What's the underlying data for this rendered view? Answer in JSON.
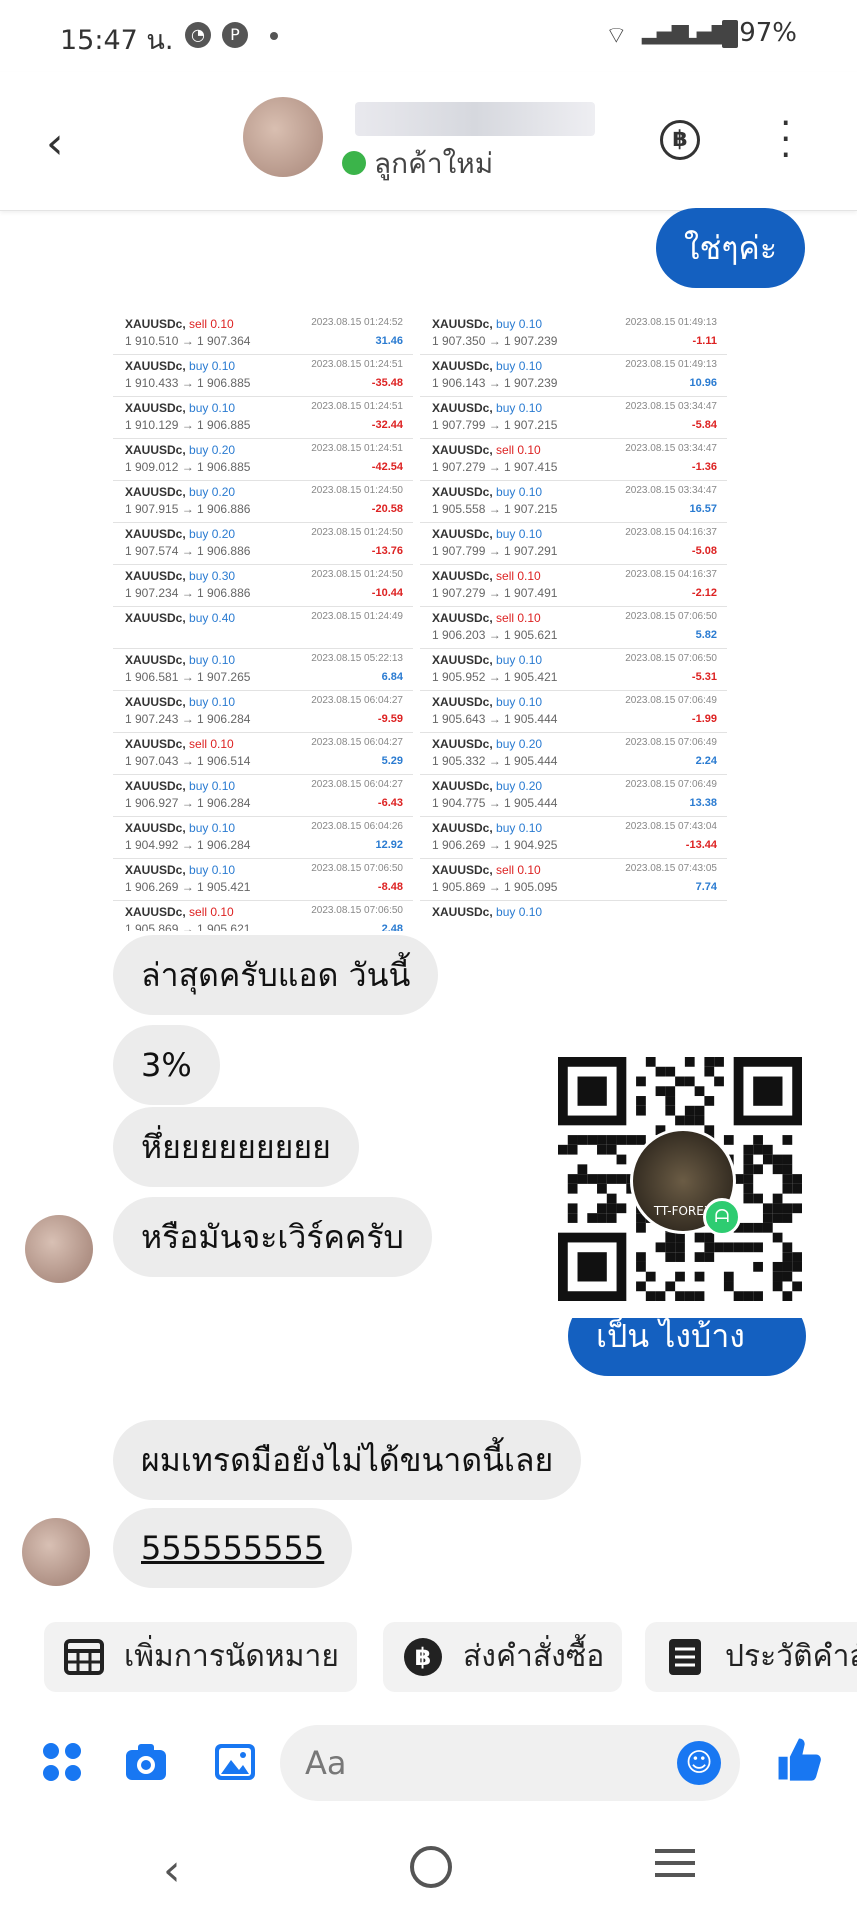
{
  "status_bar": {
    "time": "15:47 น.",
    "right": "97%"
  },
  "header": {
    "status": "ลูกค้าใหม่",
    "currency_symbol": "฿"
  },
  "messages": {
    "out_1": "ใช่ๆค่ะ",
    "in_1": "ล่าสุดครับแอด วันนี้",
    "in_2": "3%",
    "in_3": "หึ่ยยยยยยยยย",
    "in_4": "หรือมันจะเวิร์คครับ",
    "out_2": "เป็น ไงบ้างคะ",
    "in_5": "ผมเทรดมือยังไม่ได้ขนาดนี้เลย",
    "in_6": "555555555"
  },
  "trades_left": [
    {
      "sym": "XAUUSDc,",
      "side": "sell",
      "lot": "0.10",
      "price": "1 910.510 → 1 907.364",
      "date": "2023.08.15 01:24:52",
      "pnl": "31.46"
    },
    {
      "sym": "XAUUSDc,",
      "side": "buy",
      "lot": "0.10",
      "price": "1 910.433 → 1 906.885",
      "date": "2023.08.15 01:24:51",
      "pnl": "-35.48"
    },
    {
      "sym": "XAUUSDc,",
      "side": "buy",
      "lot": "0.10",
      "price": "1 910.129 → 1 906.885",
      "date": "2023.08.15 01:24:51",
      "pnl": "-32.44"
    },
    {
      "sym": "XAUUSDc,",
      "side": "buy",
      "lot": "0.20",
      "price": "1 909.012 → 1 906.885",
      "date": "2023.08.15 01:24:51",
      "pnl": "-42.54"
    },
    {
      "sym": "XAUUSDc,",
      "side": "buy",
      "lot": "0.20",
      "price": "1 907.915 → 1 906.886",
      "date": "2023.08.15 01:24:50",
      "pnl": "-20.58"
    },
    {
      "sym": "XAUUSDc,",
      "side": "buy",
      "lot": "0.20",
      "price": "1 907.574 → 1 906.886",
      "date": "2023.08.15 01:24:50",
      "pnl": "-13.76"
    },
    {
      "sym": "XAUUSDc,",
      "side": "buy",
      "lot": "0.30",
      "price": "1 907.234 → 1 906.886",
      "date": "2023.08.15 01:24:50",
      "pnl": "-10.44"
    },
    {
      "sym": "XAUUSDc,",
      "side": "buy",
      "lot": "0.40",
      "price": "",
      "date": "2023.08.15 01:24:49",
      "pnl": ""
    },
    {
      "sym": "XAUUSDc,",
      "side": "buy",
      "lot": "0.10",
      "price": "1 906.581 → 1 907.265",
      "date": "2023.08.15 05:22:13",
      "pnl": "6.84"
    },
    {
      "sym": "XAUUSDc,",
      "side": "buy",
      "lot": "0.10",
      "price": "1 907.243 → 1 906.284",
      "date": "2023.08.15 06:04:27",
      "pnl": "-9.59"
    },
    {
      "sym": "XAUUSDc,",
      "side": "sell",
      "lot": "0.10",
      "price": "1 907.043 → 1 906.514",
      "date": "2023.08.15 06:04:27",
      "pnl": "5.29"
    },
    {
      "sym": "XAUUSDc,",
      "side": "buy",
      "lot": "0.10",
      "price": "1 906.927 → 1 906.284",
      "date": "2023.08.15 06:04:27",
      "pnl": "-6.43"
    },
    {
      "sym": "XAUUSDc,",
      "side": "buy",
      "lot": "0.10",
      "price": "1 904.992 → 1 906.284",
      "date": "2023.08.15 06:04:26",
      "pnl": "12.92"
    },
    {
      "sym": "XAUUSDc,",
      "side": "buy",
      "lot": "0.10",
      "price": "1 906.269 → 1 905.421",
      "date": "2023.08.15 07:06:50",
      "pnl": "-8.48"
    },
    {
      "sym": "XAUUSDc,",
      "side": "sell",
      "lot": "0.10",
      "price": "1 905.869 → 1 905.621",
      "date": "2023.08.15 07:06:50",
      "pnl": "2.48"
    }
  ],
  "trades_right": [
    {
      "sym": "XAUUSDc,",
      "side": "buy",
      "lot": "0.10",
      "price": "1 907.350 → 1 907.239",
      "date": "2023.08.15 01:49:13",
      "pnl": "-1.11"
    },
    {
      "sym": "XAUUSDc,",
      "side": "buy",
      "lot": "0.10",
      "price": "1 906.143 → 1 907.239",
      "date": "2023.08.15 01:49:13",
      "pnl": "10.96"
    },
    {
      "sym": "XAUUSDc,",
      "side": "buy",
      "lot": "0.10",
      "price": "1 907.799 → 1 907.215",
      "date": "2023.08.15 03:34:47",
      "pnl": "-5.84"
    },
    {
      "sym": "XAUUSDc,",
      "side": "sell",
      "lot": "0.10",
      "price": "1 907.279 → 1 907.415",
      "date": "2023.08.15 03:34:47",
      "pnl": "-1.36"
    },
    {
      "sym": "XAUUSDc,",
      "side": "buy",
      "lot": "0.10",
      "price": "1 905.558 → 1 907.215",
      "date": "2023.08.15 03:34:47",
      "pnl": "16.57"
    },
    {
      "sym": "XAUUSDc,",
      "side": "buy",
      "lot": "0.10",
      "price": "1 907.799 → 1 907.291",
      "date": "2023.08.15 04:16:37",
      "pnl": "-5.08"
    },
    {
      "sym": "XAUUSDc,",
      "side": "sell",
      "lot": "0.10",
      "price": "1 907.279 → 1 907.491",
      "date": "2023.08.15 04:16:37",
      "pnl": "-2.12"
    },
    {
      "sym": "XAUUSDc,",
      "side": "sell",
      "lot": "0.10",
      "price": "1 906.203 → 1 905.621",
      "date": "2023.08.15 07:06:50",
      "pnl": "5.82"
    },
    {
      "sym": "XAUUSDc,",
      "side": "buy",
      "lot": "0.10",
      "price": "1 905.952 → 1 905.421",
      "date": "2023.08.15 07:06:50",
      "pnl": "-5.31"
    },
    {
      "sym": "XAUUSDc,",
      "side": "buy",
      "lot": "0.10",
      "price": "1 905.643 → 1 905.444",
      "date": "2023.08.15 07:06:49",
      "pnl": "-1.99"
    },
    {
      "sym": "XAUUSDc,",
      "side": "buy",
      "lot": "0.20",
      "price": "1 905.332 → 1 905.444",
      "date": "2023.08.15 07:06:49",
      "pnl": "2.24"
    },
    {
      "sym": "XAUUSDc,",
      "side": "buy",
      "lot": "0.20",
      "price": "1 904.775 → 1 905.444",
      "date": "2023.08.15 07:06:49",
      "pnl": "13.38"
    },
    {
      "sym": "XAUUSDc,",
      "side": "buy",
      "lot": "0.10",
      "price": "1 906.269 → 1 904.925",
      "date": "2023.08.15 07:43:04",
      "pnl": "-13.44"
    },
    {
      "sym": "XAUUSDc,",
      "side": "sell",
      "lot": "0.10",
      "price": "1 905.869 → 1 905.095",
      "date": "2023.08.15 07:43:05",
      "pnl": "7.74"
    },
    {
      "sym": "XAUUSDc,",
      "side": "buy",
      "lot": "0.10",
      "price": "",
      "date": "",
      "pnl": ""
    }
  ],
  "qr": {
    "logo_text": "TT-FOREX"
  },
  "quick_replies": [
    {
      "label": "เพิ่มการนัดหมาย",
      "icon": "calendar-icon"
    },
    {
      "label": "ส่งคำสั่งซื้อ",
      "icon": "baht-icon"
    },
    {
      "label": "ประวัติคำสั่ง",
      "icon": "receipt-icon"
    }
  ],
  "composer": {
    "placeholder": "Aa"
  },
  "colors": {
    "outgoing": "#1460c0",
    "incoming": "#ececec",
    "accent": "#1877f2",
    "online": "#3bb44a"
  }
}
